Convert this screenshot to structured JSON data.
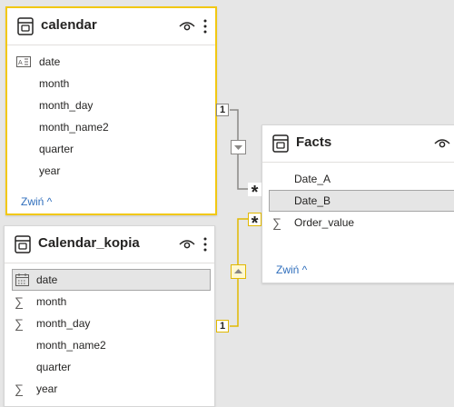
{
  "tables": {
    "calendar": {
      "title": "calendar",
      "fields": [
        {
          "name": "date",
          "icon": "text-calendar-icon"
        },
        {
          "name": "month",
          "icon": ""
        },
        {
          "name": "month_day",
          "icon": ""
        },
        {
          "name": "month_name2",
          "icon": ""
        },
        {
          "name": "quarter",
          "icon": ""
        },
        {
          "name": "year",
          "icon": ""
        }
      ],
      "collapse_label": "Zwiń ^"
    },
    "calendar_kopia": {
      "title": "Calendar_kopia",
      "fields": [
        {
          "name": "date",
          "icon": "calendar-icon"
        },
        {
          "name": "month",
          "icon": "sigma-icon"
        },
        {
          "name": "month_day",
          "icon": "sigma-icon"
        },
        {
          "name": "month_name2",
          "icon": ""
        },
        {
          "name": "quarter",
          "icon": ""
        },
        {
          "name": "year",
          "icon": "sigma-icon"
        }
      ]
    },
    "facts": {
      "title": "Facts",
      "fields": [
        {
          "name": "Date_A",
          "icon": ""
        },
        {
          "name": "Date_B",
          "icon": ""
        },
        {
          "name": "Order_value",
          "icon": "sigma-icon"
        }
      ],
      "collapse_label": "Zwiń ^"
    }
  },
  "relationships": {
    "calendar_to_facts": {
      "one_label": "1",
      "many_label": "*",
      "active": false
    },
    "kopia_to_facts": {
      "one_label": "1",
      "many_label": "*",
      "active": true
    }
  },
  "glyphs": {
    "sigma": "∑"
  },
  "colors": {
    "selected_border": "#f2c811",
    "link": "#2f6ebc",
    "canvas": "#e6e6e6",
    "highlight": "#e5e5e5"
  }
}
